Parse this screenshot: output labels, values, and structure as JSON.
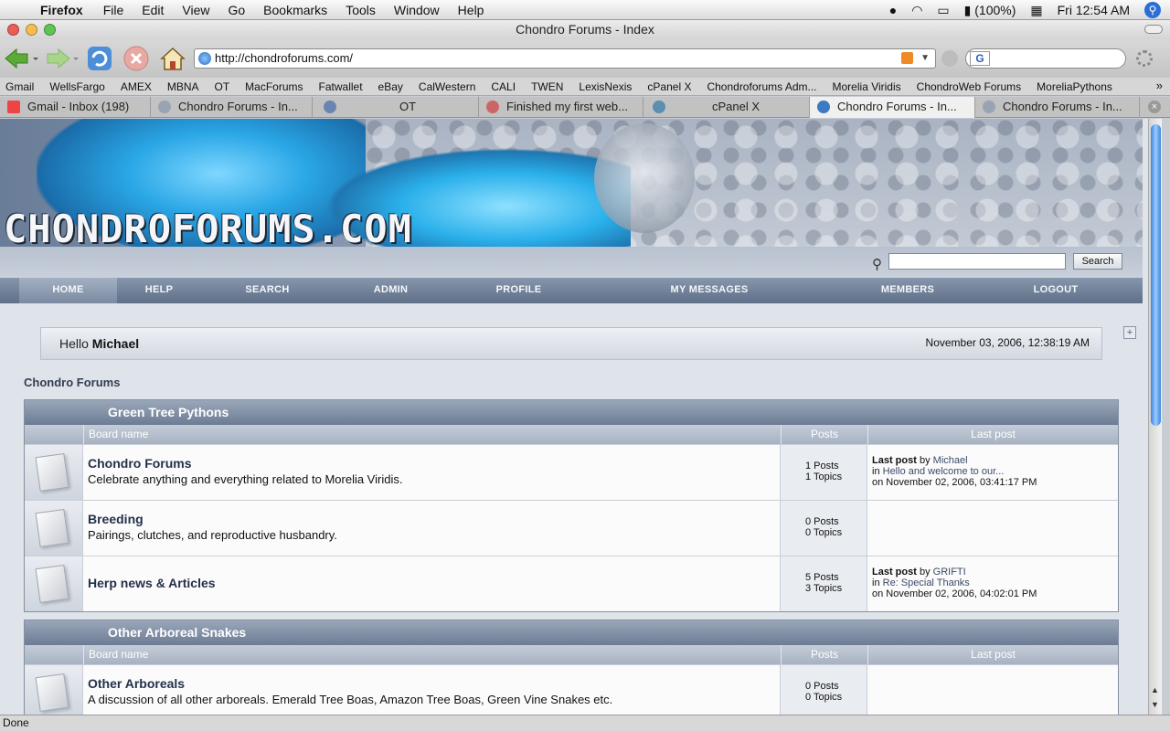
{
  "menubar": {
    "app": "Firefox",
    "items": [
      "File",
      "Edit",
      "View",
      "Go",
      "Bookmarks",
      "Tools",
      "Window",
      "Help"
    ],
    "battery": "(100%)",
    "clock": "Fri 12:54 AM"
  },
  "window": {
    "title": "Chondro Forums - Index"
  },
  "toolbar": {
    "url": "http://chondroforums.com/"
  },
  "bookmarks": [
    "Gmail",
    "WellsFargo",
    "AMEX",
    "MBNA",
    "OT",
    "MacForums",
    "Fatwallet",
    "eBay",
    "CalWestern",
    "CALI",
    "TWEN",
    "LexisNexis",
    "cPanel X",
    "Chondroforums Adm...",
    "Morelia Viridis",
    "ChondroWeb Forums",
    "MoreliaPythons"
  ],
  "tabs": [
    {
      "label": "Gmail - Inbox (198)"
    },
    {
      "label": "Chondro Forums - In..."
    },
    {
      "label": "OT"
    },
    {
      "label": "Finished my first web..."
    },
    {
      "label": "cPanel X"
    },
    {
      "label": "Chondro Forums - In..."
    },
    {
      "label": "Chondro Forums - In..."
    }
  ],
  "site": {
    "logo": "CHONDROFORUMS.COM",
    "search_button": "Search",
    "nav": [
      "HOME",
      "HELP",
      "SEARCH",
      "ADMIN",
      "PROFILE",
      "MY MESSAGES",
      "MEMBERS",
      "LOGOUT"
    ],
    "hello_prefix": "Hello",
    "user": "Michael",
    "date": "November 03, 2006, 12:38:19 AM",
    "breadcrumb": "Chondro Forums"
  },
  "columns": {
    "board": "Board name",
    "posts": "Posts",
    "last": "Last post"
  },
  "categories": [
    {
      "name": "Green Tree Pythons",
      "boards": [
        {
          "name": "Chondro Forums",
          "desc": "Celebrate anything and everything related to Morelia Viridis.",
          "posts": "1 Posts",
          "topics": "1 Topics",
          "last_label": "Last post",
          "last_by": "by",
          "last_user": "Michael",
          "last_in": "in",
          "last_topic": "Hello and welcome to our...",
          "last_on": "on November 02, 2006, 03:41:17 PM"
        },
        {
          "name": "Breeding",
          "desc": "Pairings, clutches, and reproductive husbandry.",
          "posts": "0 Posts",
          "topics": "0 Topics",
          "last_label": "",
          "last_by": "",
          "last_user": "",
          "last_in": "",
          "last_topic": "",
          "last_on": ""
        },
        {
          "name": "Herp news & Articles",
          "desc": "",
          "posts": "5 Posts",
          "topics": "3 Topics",
          "last_label": "Last post",
          "last_by": "by",
          "last_user": "GRIFTI",
          "last_in": "in",
          "last_topic": "Re: Special Thanks",
          "last_on": "on November 02, 2006, 04:02:01 PM"
        }
      ]
    },
    {
      "name": "Other Arboreal Snakes",
      "boards": [
        {
          "name": "Other Arboreals",
          "desc": "A discussion of all other arboreals. Emerald Tree Boas, Amazon Tree Boas, Green Vine Snakes etc.",
          "posts": "0 Posts",
          "topics": "0 Topics",
          "last_label": "",
          "last_by": "",
          "last_user": "",
          "last_in": "",
          "last_topic": "",
          "last_on": ""
        }
      ]
    }
  ],
  "status": "Done",
  "colors": {
    "nav": "#6d7d95",
    "accent": "#24304a"
  }
}
